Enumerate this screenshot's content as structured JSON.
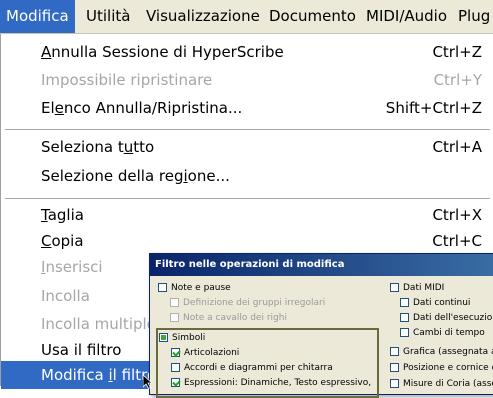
{
  "menubar": {
    "items": [
      {
        "label": "Modifica",
        "active": true
      },
      {
        "label": "Utilità"
      },
      {
        "label": "Visualizzazione"
      },
      {
        "label": "Documento"
      },
      {
        "label": "MIDI/Audio"
      },
      {
        "label": "Plug"
      }
    ]
  },
  "menu": {
    "items": [
      {
        "pre": "",
        "u": "A",
        "post": "nnulla Sessione di HyperScribe",
        "shortcut": "Ctrl+Z"
      },
      {
        "pre": "Impossibile ripristinare",
        "u": "",
        "post": "",
        "shortcut": "Ctrl+Y"
      },
      {
        "pre": "El",
        "u": "e",
        "post": "nco Annulla/Ripristina...",
        "shortcut": "Shift+Ctrl+Z"
      },
      {
        "pre": "Seleziona t",
        "u": "u",
        "post": "tto",
        "shortcut": "Ctrl+A"
      },
      {
        "pre": "Selezione della reg",
        "u": "i",
        "post": "one...",
        "shortcut": ""
      },
      {
        "pre": "",
        "u": "T",
        "post": "aglia",
        "shortcut": "Ctrl+X"
      },
      {
        "pre": "",
        "u": "C",
        "post": "opia",
        "shortcut": "Ctrl+C"
      },
      {
        "pre": "",
        "u": "I",
        "post": "nserisci",
        "shortcut": ""
      },
      {
        "pre": "Incolla",
        "u": "",
        "post": "",
        "shortcut": ""
      },
      {
        "pre": "Incolla multiplo",
        "u": "",
        "post": "",
        "shortcut": ""
      },
      {
        "pre": "Usa il filtro",
        "u": "",
        "post": "",
        "shortcut": ""
      },
      {
        "pre": "Modifica ",
        "u": "i",
        "post": "l filtro",
        "shortcut": ""
      }
    ]
  },
  "dialog": {
    "title": "Filtro nelle operazioni di modifica",
    "left": {
      "note_pause": "Note e pause",
      "definizione": "Definizione dei gruppi irregolari",
      "note_cavallo": "Note a cavallo dei righi",
      "simboli": "Simboli",
      "articolazioni": "Articolazioni",
      "accordi": "Accordi e diagrammi per chitarra",
      "espressioni": "Espressioni: Dinamiche, Testo espressivo,"
    },
    "right": {
      "dati_midi": "Dati MIDI",
      "dati_continui": "Dati continui",
      "dati_esecuzione": "Dati dell'esecuzione",
      "cambi_tempo": "Cambi di tempo",
      "grafica": "Grafica (assegnata alle r",
      "posizione": "Posizione e cornice dei n",
      "misure": "Misure di Coria (assegna"
    }
  },
  "colors": {
    "highlight": "#316ac5",
    "menubar_bg": "#ece9d8",
    "disabled_text": "#a6a6a6",
    "dialog_title": "#0a246a"
  },
  "icons": {
    "cursor": "mouse-pointer-icon",
    "check": "checkmark-icon"
  }
}
